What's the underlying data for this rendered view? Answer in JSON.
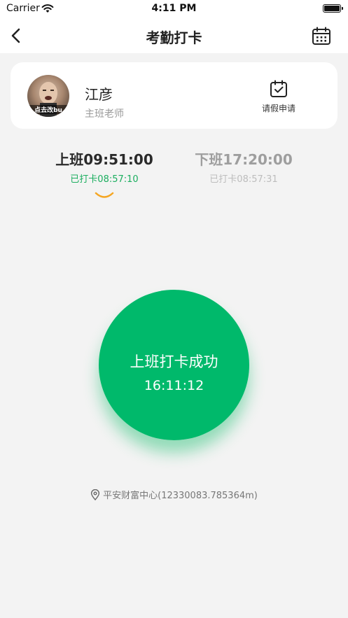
{
  "status_bar": {
    "carrier": "Carrier",
    "time": "4:11 PM"
  },
  "nav": {
    "title": "考勤打卡",
    "back_icon": "chevron-left-icon",
    "calendar_icon": "calendar-icon"
  },
  "user": {
    "name": "江彦",
    "role": "主班老师",
    "avatar_caption": "点去改bu",
    "leave_label": "请假申请",
    "leave_icon": "calendar-check-icon"
  },
  "shifts": [
    {
      "label": "上班09:51:00",
      "status": "已打卡08:57:10",
      "active": true
    },
    {
      "label": "下班17:20:00",
      "status": "已打卡08:57:31",
      "active": false
    }
  ],
  "punch": {
    "label": "上班打卡成功",
    "time": "16:11:12"
  },
  "location": {
    "text": "平安财富中心(12330083.785364m)"
  },
  "colors": {
    "accent_green": "#00b96b",
    "status_green": "#1bae5f",
    "indicator_orange": "#f5a623",
    "background": "#f3f3f3"
  }
}
